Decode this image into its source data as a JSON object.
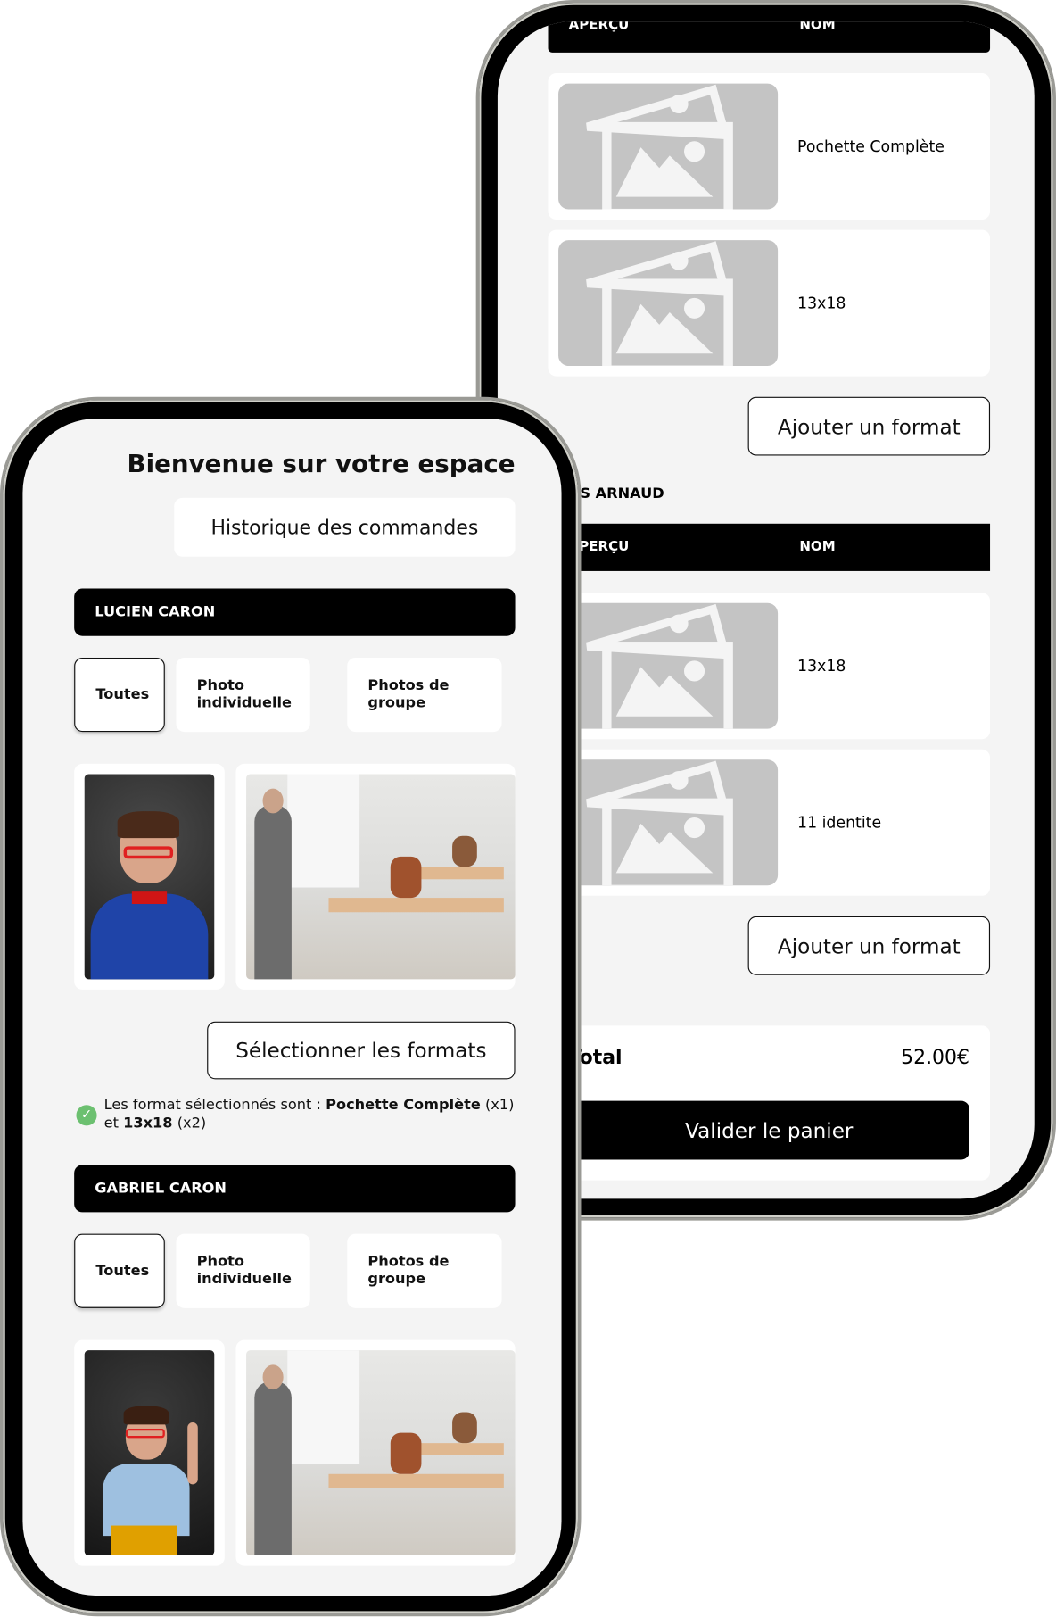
{
  "back_screen": {
    "table1": {
      "col_preview": "APERÇU",
      "col_name": "NOM",
      "rows": [
        {
          "name": "Pochette Complète"
        },
        {
          "name": "13x18"
        }
      ],
      "add_button": "Ajouter un format"
    },
    "student2_label": "S ARNAUD",
    "table2": {
      "col_preview": "APERÇU",
      "col_name": "NOM",
      "rows": [
        {
          "name": "13x18"
        },
        {
          "name": "11 identite"
        }
      ],
      "add_button": "Ajouter un format"
    },
    "total_label": "Total",
    "total_value": "52.00€",
    "validate_button": "Valider le panier"
  },
  "front_screen": {
    "title": "Bienvenue sur votre espace",
    "history_button": "Historique des commandes",
    "students": [
      {
        "name": "LUCIEN CARON",
        "tabs": [
          "Toutes",
          "Photo individuelle",
          "Photos de groupe"
        ],
        "selected_tab": "Toutes",
        "select_button": "Sélectionner les formats",
        "message": {
          "prefix": "Les format sélectionnés sont : ",
          "item1": "Pochette Complète",
          "qty1": " (x1)",
          "join": "et ",
          "item2": "13x18",
          "qty2": " (x2)"
        }
      },
      {
        "name": "GABRIEL CARON",
        "tabs": [
          "Toutes",
          "Photo individuelle",
          "Photos de groupe"
        ],
        "selected_tab": "Toutes"
      }
    ]
  },
  "colors": {
    "success": "#6cc070",
    "placeholder": "#c4c4c4",
    "background": "#f4f4f4"
  }
}
